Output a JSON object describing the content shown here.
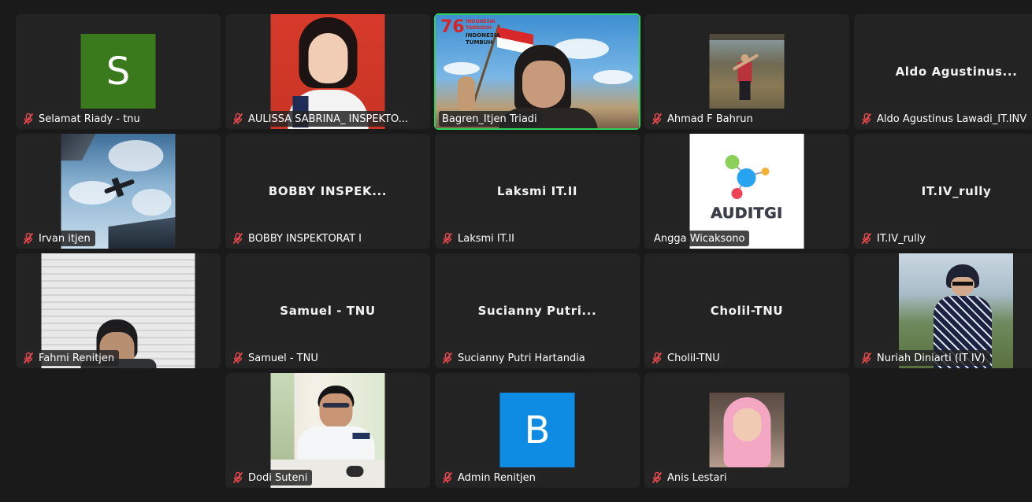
{
  "colors": {
    "background": "#1a1a1a",
    "tile": "#232323",
    "active_speaker_border": "#2ed15c",
    "muted_icon": "#e5484d",
    "avatar_s": "#3b7a1c",
    "avatar_b": "#0e8ce4"
  },
  "participants": [
    {
      "name": "Selamat Riady - tnu",
      "muted": true,
      "avatar_letter": "S"
    },
    {
      "name": "AULISSA SABRINA_ INSPEKTO...",
      "muted": true
    },
    {
      "name": "Bagren_Itjen Triadi",
      "muted": false,
      "active_speaker": true,
      "banner": {
        "number": "76",
        "line1": "INDONESIA",
        "line2": "TANGGUH",
        "line3": "INDONESIA",
        "line4": "TUMBUH"
      }
    },
    {
      "name": "Ahmad F Bahrun",
      "muted": true
    },
    {
      "name": "Aldo Agustinus Lawadi_IT.INV",
      "muted": true,
      "center_name": "Aldo Agustinus..."
    },
    {
      "name": "Irvan itjen",
      "muted": true
    },
    {
      "name": "BOBBY INSPEKTORAT I",
      "muted": true,
      "center_name": "BOBBY INSPEK..."
    },
    {
      "name": "Laksmi IT.II",
      "muted": true,
      "center_name": "Laksmi IT.II"
    },
    {
      "name": "Angga Wicaksono",
      "muted": false,
      "logo_text": "AUDITGI"
    },
    {
      "name": "IT.IV_rully",
      "muted": true,
      "center_name": "IT.IV_rully"
    },
    {
      "name": "Fahmi Renitjen",
      "muted": true
    },
    {
      "name": "Samuel - TNU",
      "muted": true,
      "center_name": "Samuel - TNU"
    },
    {
      "name": "Sucianny Putri Hartandia",
      "muted": true,
      "center_name": "Sucianny Putri..."
    },
    {
      "name": "Cholil-TNU",
      "muted": true,
      "center_name": "Cholil-TNU"
    },
    {
      "name": "Nuriah Diniarti (IT IV)",
      "muted": true
    },
    {
      "name": "Dodi Suteni",
      "muted": true
    },
    {
      "name": "Admin Renitjen",
      "muted": true,
      "avatar_letter": "B"
    },
    {
      "name": "Anis Lestari",
      "muted": true
    }
  ]
}
